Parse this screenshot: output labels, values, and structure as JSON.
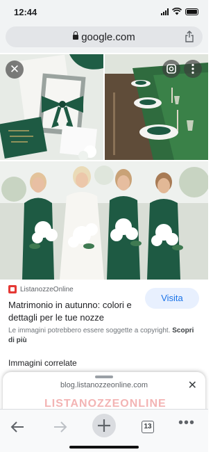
{
  "status_bar": {
    "time": "12:44"
  },
  "address_bar": {
    "url": "google.com"
  },
  "result": {
    "source": "ListanozzeOnline",
    "title": "Matrimonio in autunno: colori e dettagli per le tue nozze",
    "visit_label": "Visita",
    "copyright_text": "Le immagini potrebbero essere soggette a copyright.",
    "copyright_link": "Scopri di più"
  },
  "related": {
    "heading": "Immagini correlate"
  },
  "sheet": {
    "url": "blog.listanozzeonline.com",
    "preview_logo": "LISTANOZZEONLINE"
  },
  "toolbar": {
    "tab_count": "13"
  },
  "colors": {
    "accent": "#1a73e8",
    "emerald": "#1e5a43",
    "brand_red": "#e53935"
  }
}
